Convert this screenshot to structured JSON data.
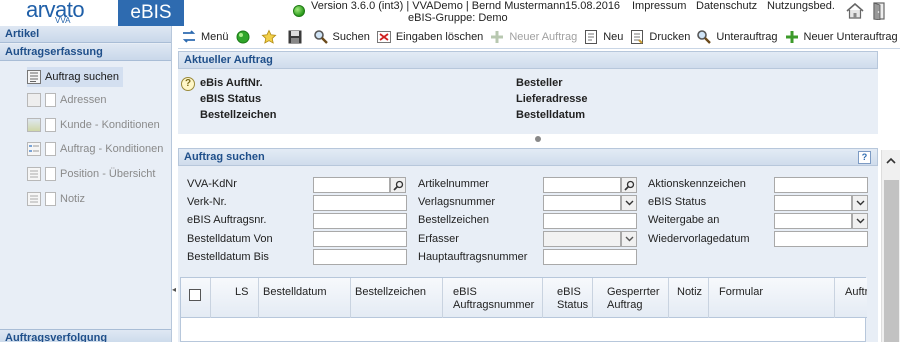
{
  "header": {
    "brand": "arvato",
    "brand_sub": "VVA",
    "app_tab": "eBIS",
    "version": "Version 3.6.0 (int3) | VVADemo | Bernd Mustermann",
    "group": "eBIS-Gruppe: Demo",
    "date": "15.08.2016",
    "links": [
      "Impressum",
      "Datenschutz",
      "Nutzungsbed."
    ],
    "status_color": "#2a9a1c"
  },
  "sidebar": {
    "section_artikel": "Artikel",
    "section_auftragserfassung": "Auftragserfassung",
    "items": [
      {
        "label": "Auftrag suchen",
        "icon": "document-list-icon",
        "active": true
      },
      {
        "label": "Adressen",
        "icon": "address-box-icon",
        "active": false
      },
      {
        "label": "Kunde - Konditionen",
        "icon": "chart-icon",
        "active": false
      },
      {
        "label": "Auftrag - Konditionen",
        "icon": "list-icon",
        "active": false
      },
      {
        "label": "Position - Übersicht",
        "icon": "document-icon",
        "active": false
      },
      {
        "label": "Notiz",
        "icon": "note-icon",
        "active": false
      }
    ],
    "section_auftragsverfolgung": "Auftragsverfolgung"
  },
  "toolbar": {
    "menu": "Menü",
    "search": "Suchen",
    "clear": "Eingaben löschen",
    "new_order": "Neuer Auftrag",
    "new": "Neu",
    "print": "Drucken",
    "sub_order": "Unterauftrag",
    "new_sub_order": "Neuer Unterauftrag"
  },
  "current_order": {
    "title": "Aktueller Auftrag",
    "labels": {
      "order_no": "eBis AuftNr.",
      "status": "eBIS Status",
      "order_mark": "Bestellzeichen",
      "orderer": "Besteller",
      "delivery_address": "Lieferadresse",
      "order_date": "Bestelldatum"
    }
  },
  "search": {
    "title": "Auftrag suchen",
    "help": "?",
    "col1": {
      "vva_kdnr": "VVA-KdNr",
      "verk_nr": "Verk-Nr.",
      "ebis_auftragsnr": "eBIS Auftragsnr.",
      "bestelldatum_von": "Bestelldatum Von",
      "bestelldatum_bis": "Bestelldatum Bis"
    },
    "col2": {
      "artikelnummer": "Artikelnummer",
      "verlagsnummer": "Verlagsnummer",
      "bestellzeichen": "Bestellzeichen",
      "erfasser": "Erfasser",
      "hauptauftragsnummer": "Hauptauftragsnummer"
    },
    "col3": {
      "aktionskennzeichen": "Aktionskennzeichen",
      "ebis_status": "eBIS Status",
      "weitergabe_an": "Weitergabe an",
      "wiedervorlagedatum": "Wiedervorlagedatum"
    }
  },
  "results": {
    "columns": [
      "LS",
      "Bestelldatum",
      "Bestellzeichen",
      "eBIS Auftragsnummer",
      "eBIS Status",
      "Gesperrter Auftrag",
      "Notiz",
      "Formular",
      "Auftr"
    ]
  }
}
